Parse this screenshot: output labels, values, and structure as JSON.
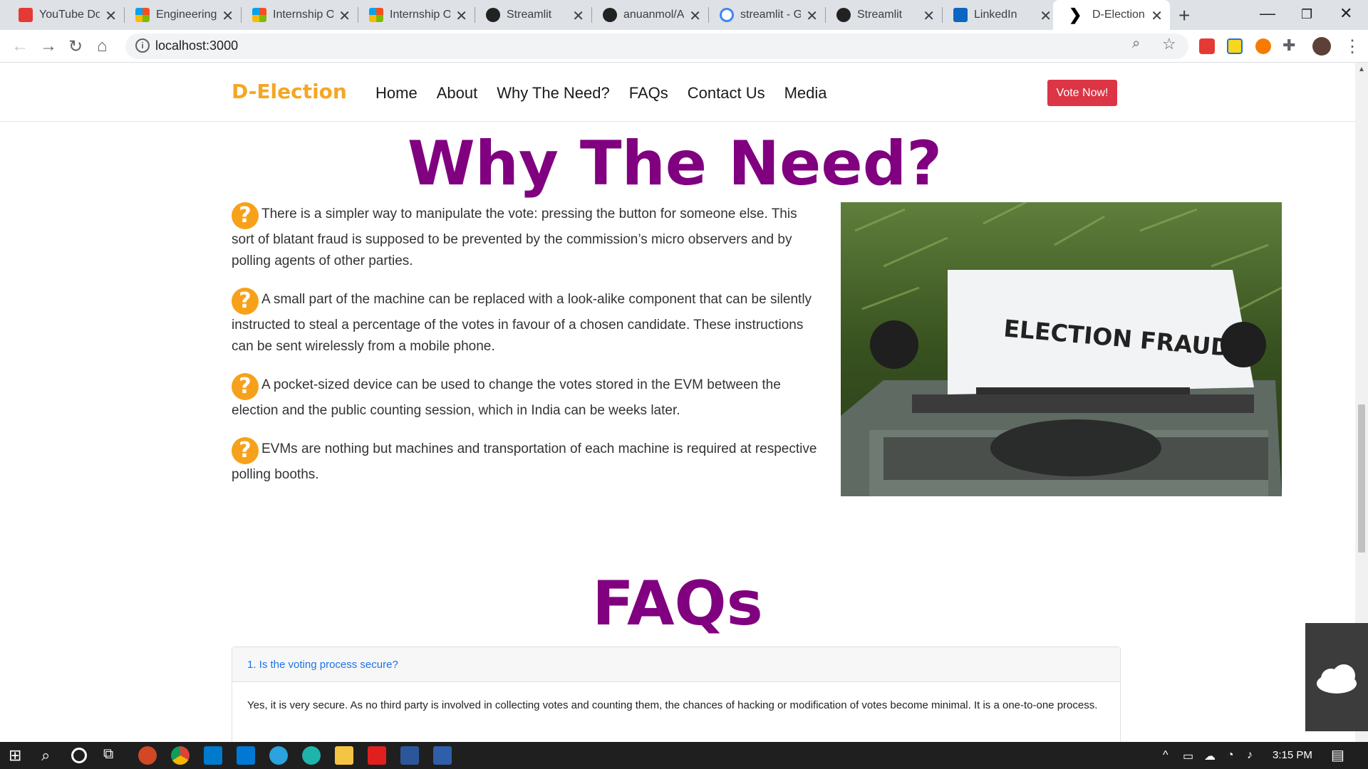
{
  "browser": {
    "tabs": [
      {
        "title": "YouTube Do",
        "color": "#e53935"
      },
      {
        "title": "Engineering",
        "color": "#f25022"
      },
      {
        "title": "Internship O",
        "color": "#f25022"
      },
      {
        "title": "Internship O",
        "color": "#f25022"
      },
      {
        "title": "Streamlit",
        "color": "#222222"
      },
      {
        "title": "anuanmol/A",
        "color": "#222222"
      },
      {
        "title": "streamlit - G",
        "color": "#4285f4"
      },
      {
        "title": "Streamlit",
        "color": "#222222"
      },
      {
        "title": "LinkedIn",
        "color": "#0a66c2"
      },
      {
        "title": "D-Election",
        "color": "#000000"
      }
    ],
    "url": "localhost:3000"
  },
  "navbar": {
    "brand": "D-Election",
    "links": [
      "Home",
      "About",
      "Why The Need?",
      "FAQs",
      "Contact Us",
      "Media"
    ],
    "cta": "Vote Now!"
  },
  "why": {
    "title": "Why The Need?",
    "reasons": [
      "There is a simpler way to manipulate the vote: pressing the button for someone else. This sort of blatant fraud is supposed to be prevented by the commission’s micro observers and by polling agents of other parties.",
      "A small part of the machine can be replaced with a look-alike component that can be silently instructed to steal a percentage of the votes in favour of a chosen candidate. These instructions can be sent wirelessly from a mobile phone.",
      "A pocket-sized device can be used to change the votes stored in the EVM between the election and the public counting session, which in India can be weeks later.",
      "EVMs are nothing but machines and transportation of each machine is required at respective polling booths."
    ],
    "image_text": "ELECTION FRAUD"
  },
  "faqs": {
    "title": "FAQs",
    "items": [
      {
        "question": "1. Is the voting process secure?",
        "answer": "Yes, it is very secure. As no third party is involved in collecting votes and counting them, the chances of hacking or modification of votes become minimal. It is a one-to-one process."
      }
    ]
  },
  "taskbar": {
    "time": "3:15 PM"
  }
}
